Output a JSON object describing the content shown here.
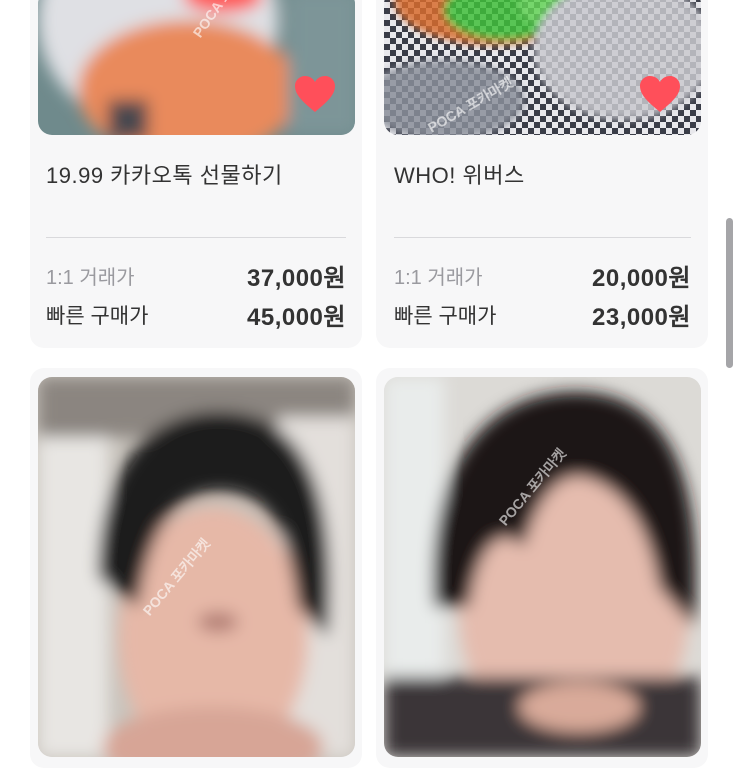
{
  "products": [
    {
      "title": "19.99 카카오톡 선물하기",
      "trade_label": "1:1 거래가",
      "trade_price": "37,000원",
      "buy_label": "빠른 구매가",
      "buy_price": "45,000원",
      "watermark": "POCA 포카마켓",
      "favorited": true
    },
    {
      "title": "WHO! 위버스",
      "trade_label": "1:1 거래가",
      "trade_price": "20,000원",
      "buy_label": "빠른 구매가",
      "buy_price": "23,000원",
      "watermark": "POCA 포카마켓",
      "favorited": true
    },
    {
      "watermark": "POCA 포카마켓"
    },
    {
      "watermark": "POCA 포카마켓"
    }
  ],
  "colors": {
    "heart": "#ff4f5a",
    "card_bg": "#f7f7f8",
    "divider": "#d9d9dc",
    "trade_label": "#9a9a9f"
  },
  "icons": {
    "favorite": "heart-icon"
  }
}
